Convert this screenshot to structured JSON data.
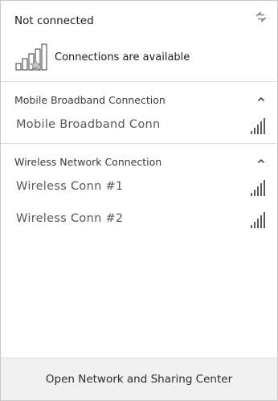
{
  "header": {
    "status": "Not connected",
    "availability": "Connections are available",
    "refresh_icon": "refresh-arrows-icon",
    "availability_icon": "signal-bars-with-star-icon"
  },
  "sections": [
    {
      "title": "Mobile Broadband Connection",
      "collapse_icon": "chevron-up-icon",
      "items": [
        {
          "name": "Mobile Broadband Conn",
          "signal_icon": "signal-strength-icon"
        }
      ]
    },
    {
      "title": "Wireless Network Connection",
      "collapse_icon": "chevron-up-icon",
      "items": [
        {
          "name": "Wireless Conn #1",
          "signal_icon": "signal-strength-icon"
        },
        {
          "name": "Wireless Conn #2",
          "signal_icon": "signal-strength-icon"
        }
      ]
    }
  ],
  "footer": {
    "link": "Open Network and Sharing Center"
  },
  "colors": {
    "footer_bg": "#f1f1f1",
    "divider": "#dcdcdc",
    "item_text": "#575757"
  }
}
